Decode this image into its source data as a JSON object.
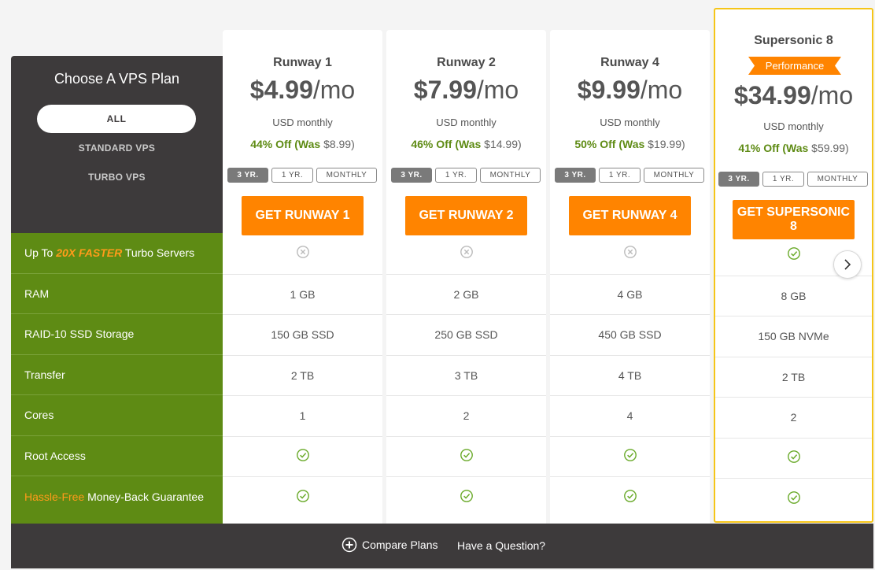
{
  "sidebar": {
    "title": "Choose A VPS Plan",
    "filters": [
      "ALL",
      "STANDARD VPS",
      "TURBO VPS"
    ]
  },
  "features": {
    "turbo": {
      "prefix": "Up To ",
      "highlight": "20X FASTER",
      "suffix": " Turbo Servers"
    },
    "ram": "RAM",
    "storage": "RAID-10 SSD Storage",
    "transfer": "Transfer",
    "cores": "Cores",
    "root": "Root Access",
    "guarantee": {
      "highlight": "Hassle-Free",
      "suffix": " Money-Back Guarantee"
    }
  },
  "terms": {
    "three": "3 YR.",
    "one": "1 YR.",
    "monthly": "MONTHLY"
  },
  "plans": [
    {
      "name": "Runway 1",
      "price": "$4.99",
      "per": "/mo",
      "usd": "USD monthly",
      "discount": "44% Off",
      "was_label": "(Was ",
      "was": "$8.99)",
      "cta": "GET RUNWAY 1",
      "ram": "1 GB",
      "storage": "150 GB SSD",
      "transfer": "2 TB",
      "cores": "1"
    },
    {
      "name": "Runway 2",
      "price": "$7.99",
      "per": "/mo",
      "usd": "USD monthly",
      "discount": "46% Off",
      "was_label": "(Was ",
      "was": "$14.99)",
      "cta": "GET RUNWAY 2",
      "ram": "2 GB",
      "storage": "250 GB SSD",
      "transfer": "3 TB",
      "cores": "2"
    },
    {
      "name": "Runway 4",
      "price": "$9.99",
      "per": "/mo",
      "usd": "USD monthly",
      "discount": "50% Off",
      "was_label": "(Was ",
      "was": "$19.99)",
      "cta": "GET RUNWAY 4",
      "ram": "4 GB",
      "storage": "450 GB SSD",
      "transfer": "4 TB",
      "cores": "4"
    },
    {
      "name": "Supersonic 8",
      "badge": "Performance",
      "price": "$34.99",
      "per": "/mo",
      "usd": "USD monthly",
      "discount": "41% Off",
      "was_label": "(Was ",
      "was": "$59.99)",
      "cta": "GET SUPERSONIC 8",
      "ram": "8 GB",
      "storage": "150 GB NVMe",
      "transfer": "2 TB",
      "cores": "2"
    }
  ],
  "footer": {
    "compare": "Compare Plans",
    "question": "Have a Question?"
  },
  "colors": {
    "dark": "#3d3a3b",
    "green": "#5e8b14",
    "orange": "#ff8400",
    "highlight": "#f5c518",
    "check": "#6aaa2a",
    "cross": "#bbbbbb"
  }
}
